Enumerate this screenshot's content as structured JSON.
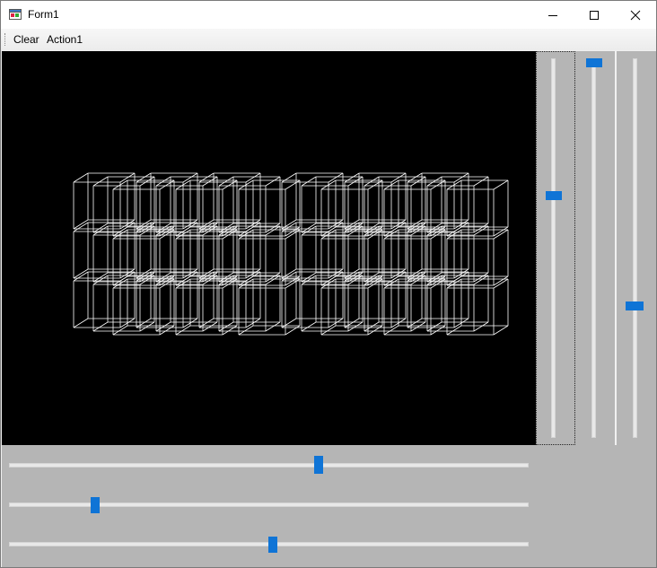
{
  "window": {
    "title": "Form1"
  },
  "menu": {
    "clear": "Clear",
    "action1": "Action1"
  },
  "sliders": {
    "vertical": [
      {
        "name": "slider-v1",
        "value": 0.36
      },
      {
        "name": "slider-v2",
        "value": 0.0
      },
      {
        "name": "slider-v3",
        "value": 0.66
      }
    ],
    "horizontal": [
      {
        "name": "slider-h1",
        "value": 0.6
      },
      {
        "name": "slider-h2",
        "value": 0.16
      },
      {
        "name": "slider-h3",
        "value": 0.51
      }
    ]
  },
  "colors": {
    "canvas": "#000000",
    "wire": "#ffffff",
    "panel": "#b5b5b5",
    "thumb": "#0f74d6"
  }
}
